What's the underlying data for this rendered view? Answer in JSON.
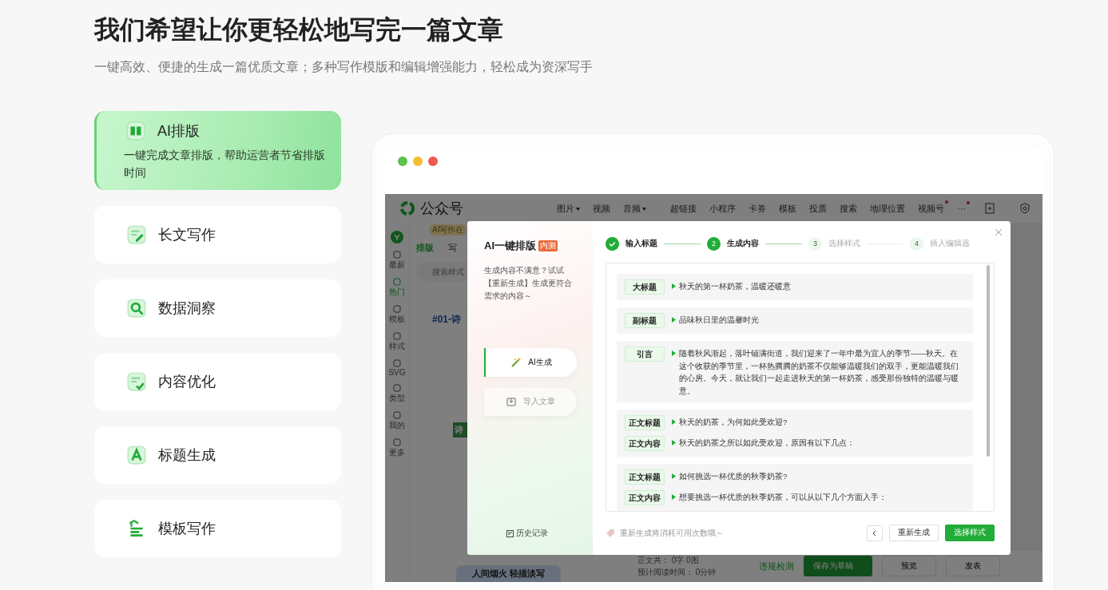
{
  "heading": "我们希望让你更轻松地写完一篇文章",
  "subheading": "一键高效、便捷的生成一篇优质文章；多种写作模版和编辑增强能力，轻松成为资深写手",
  "features": [
    {
      "title": "AI排版",
      "desc": "一键完成文章排版，帮助运营者节省排版时间",
      "selected": true,
      "kind": "layout"
    },
    {
      "title": "长文写作",
      "selected": false,
      "kind": "write"
    },
    {
      "title": "数据洞察",
      "selected": false,
      "kind": "insight"
    },
    {
      "title": "内容优化",
      "selected": false,
      "kind": "optimize"
    },
    {
      "title": "标题生成",
      "selected": false,
      "kind": "title"
    },
    {
      "title": "模板写作",
      "selected": false,
      "kind": "template"
    }
  ],
  "app": {
    "brand": "公众号",
    "toolbar": [
      {
        "label": "图片",
        "dropdown": true,
        "dot": false
      },
      {
        "label": "视频",
        "dropdown": false,
        "dot": false
      },
      {
        "label": "音频",
        "dropdown": true,
        "dot": false
      },
      {
        "label": "超链接",
        "dropdown": false,
        "dot": false
      },
      {
        "label": "小程序",
        "dropdown": false,
        "dot": false
      },
      {
        "label": "卡券",
        "dropdown": false,
        "dot": false
      },
      {
        "label": "模板",
        "dropdown": false,
        "dot": false
      },
      {
        "label": "投票",
        "dropdown": false,
        "dot": false
      },
      {
        "label": "搜索",
        "dropdown": false,
        "dot": false
      },
      {
        "label": "地理位置",
        "dropdown": false,
        "dot": false
      },
      {
        "label": "视频号",
        "dropdown": false,
        "dot": true
      },
      {
        "label": "···",
        "dropdown": false,
        "dot": true
      }
    ],
    "rail": [
      {
        "label": "最新",
        "selected": false
      },
      {
        "label": "热门",
        "selected": true
      },
      {
        "label": "模板",
        "selected": false
      },
      {
        "label": "样式",
        "selected": false
      },
      {
        "label": "SVG",
        "selected": false
      },
      {
        "label": "类型",
        "selected": false
      },
      {
        "label": "我的",
        "selected": false
      },
      {
        "label": "更多",
        "selected": false
      }
    ],
    "badge": "AI写作在",
    "panel_tabs": [
      {
        "label": "排版",
        "selected": true
      },
      {
        "label": "写",
        "selected": false
      }
    ],
    "search_placeholder": "搜索样式",
    "template_title": "#01-诗",
    "template_tag": "诗",
    "banner": "人间烟火 轻描淡写",
    "stats": [
      {
        "label": "正文共：",
        "value": "0字 0图"
      },
      {
        "label": "预计阅读时间：",
        "value": "0分钟"
      }
    ],
    "check": "违规检测",
    "save": "保存为草稿",
    "preview": "预览",
    "publish": "发表"
  },
  "modal": {
    "title": "AI一键排版",
    "tag": "内测",
    "note": "生成内容不满意？试试【重新生成】生成更符合需求的内容～",
    "modes": [
      {
        "label": "AI生成",
        "selected": true
      },
      {
        "label": "导入文章",
        "selected": false
      }
    ],
    "history": "历史记录",
    "steps": [
      {
        "label": "输入标题",
        "done": true,
        "current": false
      },
      {
        "number": "2",
        "label": "生成内容",
        "done": false,
        "current": true
      },
      {
        "number": "3",
        "label": "选择样式",
        "done": false,
        "current": false
      },
      {
        "number": "4",
        "label": "插入编辑器",
        "done": false,
        "current": false
      }
    ],
    "groups": [
      {
        "items": [
          {
            "tag": "大标题",
            "text": "秋天的第一杯奶茶，温暖还暖意"
          }
        ]
      },
      {
        "items": [
          {
            "tag": "副标题",
            "text": "品味秋日里的温馨时光"
          }
        ]
      },
      {
        "items": [
          {
            "tag": "引言",
            "text": "随着秋风渐起，落叶铺满街道，我们迎来了一年中最为宜人的季节——秋天。在这个收获的季节里，一杯热腾腾的奶茶不仅能够温暖我们的双手，更能温暖我们的心房。今天，就让我们一起走进秋天的第一杯奶茶，感受那份独特的温暖与暖意。"
          }
        ]
      },
      {
        "items": [
          {
            "tag": "正文标题",
            "text": "秋天的奶茶，为何如此受欢迎?"
          },
          {
            "tag": "正文内容",
            "text": "秋天的奶茶之所以如此受欢迎，原因有以下几点："
          }
        ]
      },
      {
        "items": [
          {
            "tag": "正文标题",
            "text": "如何挑选一杯优质的秋季奶茶?"
          },
          {
            "tag": "正文内容",
            "text": "想要挑选一杯优质的秋季奶茶，可以从以下几个方面入手："
          }
        ]
      }
    ],
    "footer_note": "重新生成将消耗可用次数哦～",
    "regenerate": "重新生成",
    "next": "选择样式"
  }
}
